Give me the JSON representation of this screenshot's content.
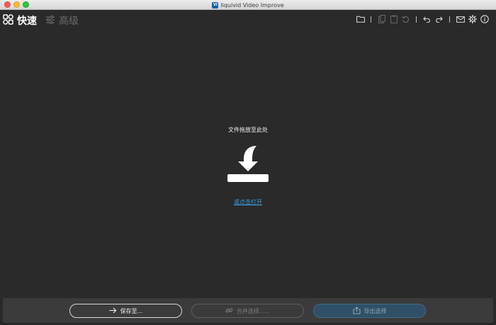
{
  "window": {
    "title": "liquivid Video Improve",
    "app_icon_text": "VI"
  },
  "tabs": [
    {
      "label": "快速",
      "icon": "grid-icon",
      "active": true
    },
    {
      "label": "高级",
      "icon": "sliders-icon",
      "active": false
    }
  ],
  "toolbar": {
    "icons": [
      "folder-icon",
      "copy-icon",
      "clipboard-icon",
      "reset-icon",
      "undo-icon",
      "redo-icon",
      "mail-icon",
      "gear-icon",
      "info-icon"
    ]
  },
  "drop": {
    "title": "文件拖放至此处",
    "icon": "download-tray-icon",
    "open_link": "或点击打开"
  },
  "bottom": {
    "save_label": "保存至...",
    "merge_label": "合并选择......",
    "export_label": "导出选择"
  },
  "colors": {
    "background": "#2a2a2a",
    "bottom_bar": "#3b3b3b",
    "link": "#3b9ee8",
    "export_button": "#2f5066"
  }
}
